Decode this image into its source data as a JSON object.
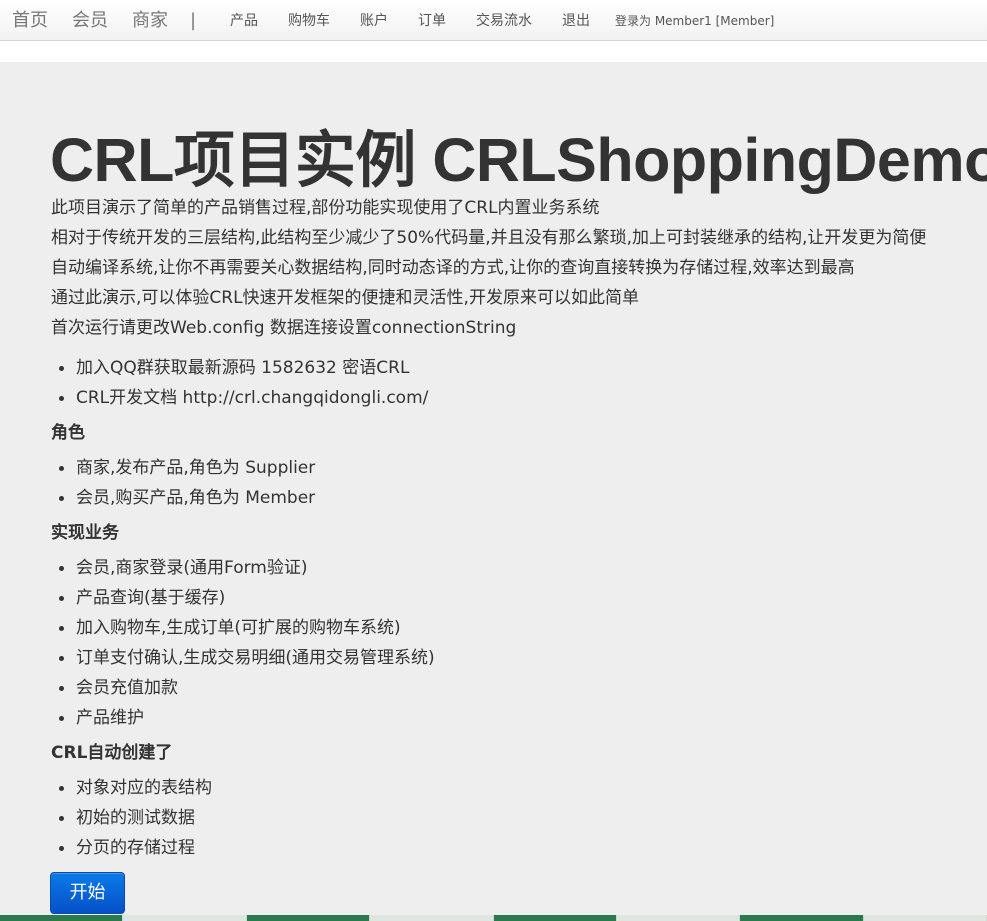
{
  "navbar": {
    "brands": [
      "首页",
      "会员",
      "商家"
    ],
    "separator": "|",
    "items": [
      "产品",
      "购物车",
      "账户",
      "订单",
      "交易流水",
      "退出"
    ],
    "login_status": "登录为 Member1 [Member]"
  },
  "hero": {
    "title": "CRL项目实例 CRLShoppingDemo",
    "paragraphs": [
      "此项目演示了简单的产品销售过程,部份功能实现使用了CRL内置业务系统",
      "相对于传统开发的三层结构,此结构至少减少了50%代码量,并且没有那么繁琐,加上可封装继承的结构,让开发更为简便",
      "自动编译系统,让你不再需要关心数据结构,同时动态译的方式,让你的查询直接转换为存储过程,效率达到最高",
      "通过此演示,可以体验CRL快速开发框架的便捷和灵活性,开发原来可以如此简单",
      "首次运行请更改Web.config 数据连接设置connectionString"
    ],
    "info_list": [
      "加入QQ群获取最新源码 1582632 密语CRL",
      "CRL开发文档 http://crl.changqidongli.com/"
    ],
    "roles_heading": "角色",
    "roles": [
      "商家,发布产品,角色为 Supplier",
      "会员,购买产品,角色为 Member"
    ],
    "features_heading": "实现业务",
    "features": [
      "会员,商家登录(通用Form验证)",
      "产品查询(基于缓存)",
      "加入购物车,生成订单(可扩展的购物车系统)",
      "订单支付确认,生成交易明细(通用交易管理系统)",
      "会员充值加款",
      "产品维护"
    ],
    "auto_heading": "CRL自动创建了",
    "auto_items": [
      "对象对应的表结构",
      "初始的测试数据",
      "分页的存储过程"
    ],
    "start_button": "开始"
  },
  "colors": {
    "navbar_bg": "#f5f5f5",
    "hero_bg": "#eeeeee",
    "text": "#333333",
    "button_primary": "#0a6fdc"
  }
}
